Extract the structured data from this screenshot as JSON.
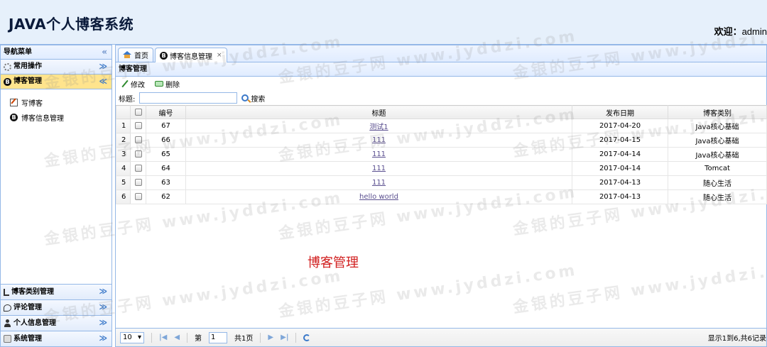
{
  "header": {
    "app_title": "JAVA个人博客系统",
    "welcome_label": "欢迎：",
    "user": "admin"
  },
  "sidebar": {
    "title": "导航菜单",
    "collapse_symbol": "«",
    "sections": [
      {
        "label": "常用操作",
        "icon": "gear-icon"
      },
      {
        "label": "博客管理",
        "icon": "blog-icon",
        "active": true
      }
    ],
    "blog_items": [
      {
        "label": "写博客",
        "icon": "edit-doc-icon"
      },
      {
        "label": "博客信息管理",
        "icon": "blog-icon"
      }
    ],
    "bottom_sections": [
      {
        "label": "博客类别管理",
        "icon": "tree-icon"
      },
      {
        "label": "评论管理",
        "icon": "comment-icon"
      },
      {
        "label": "个人信息管理",
        "icon": "person-icon"
      },
      {
        "label": "系统管理",
        "icon": "system-icon"
      }
    ]
  },
  "tabs": [
    {
      "label": "首页",
      "icon": "home-icon"
    },
    {
      "label": "博客信息管理",
      "icon": "blog-icon",
      "active": true,
      "close": "×"
    }
  ],
  "panel": {
    "title": "博客管理",
    "edit_label": "修改",
    "delete_label": "删除",
    "search_label": "标题:",
    "search_value": "",
    "search_button": "搜索"
  },
  "table": {
    "columns": [
      "编号",
      "标题",
      "发布日期",
      "博客类别"
    ],
    "rows": [
      {
        "n": "1",
        "id": "67",
        "title": "测试1",
        "date": "2017-04-20",
        "category": "Java核心基础"
      },
      {
        "n": "2",
        "id": "66",
        "title": "111",
        "date": "2017-04-15",
        "category": "Java核心基础"
      },
      {
        "n": "3",
        "id": "65",
        "title": "111",
        "date": "2017-04-14",
        "category": "Java核心基础"
      },
      {
        "n": "4",
        "id": "64",
        "title": "111",
        "date": "2017-04-14",
        "category": "Tomcat"
      },
      {
        "n": "5",
        "id": "63",
        "title": "111",
        "date": "2017-04-13",
        "category": "随心生活"
      },
      {
        "n": "6",
        "id": "62",
        "title": "hello world",
        "date": "2017-04-13",
        "category": "随心生活"
      }
    ]
  },
  "center_label": "博客管理",
  "pager": {
    "page_size": "10",
    "page_prefix": "第",
    "page_value": "1",
    "page_suffix": "共1页",
    "info": "显示1到6,共6记录"
  },
  "watermark": "金银的豆子网 www.jyddzi.com",
  "colors": {
    "border": "#95b8e7",
    "active_section": "#ffe48d",
    "link": "#5a4f8f",
    "center_label": "#d11f1f"
  }
}
